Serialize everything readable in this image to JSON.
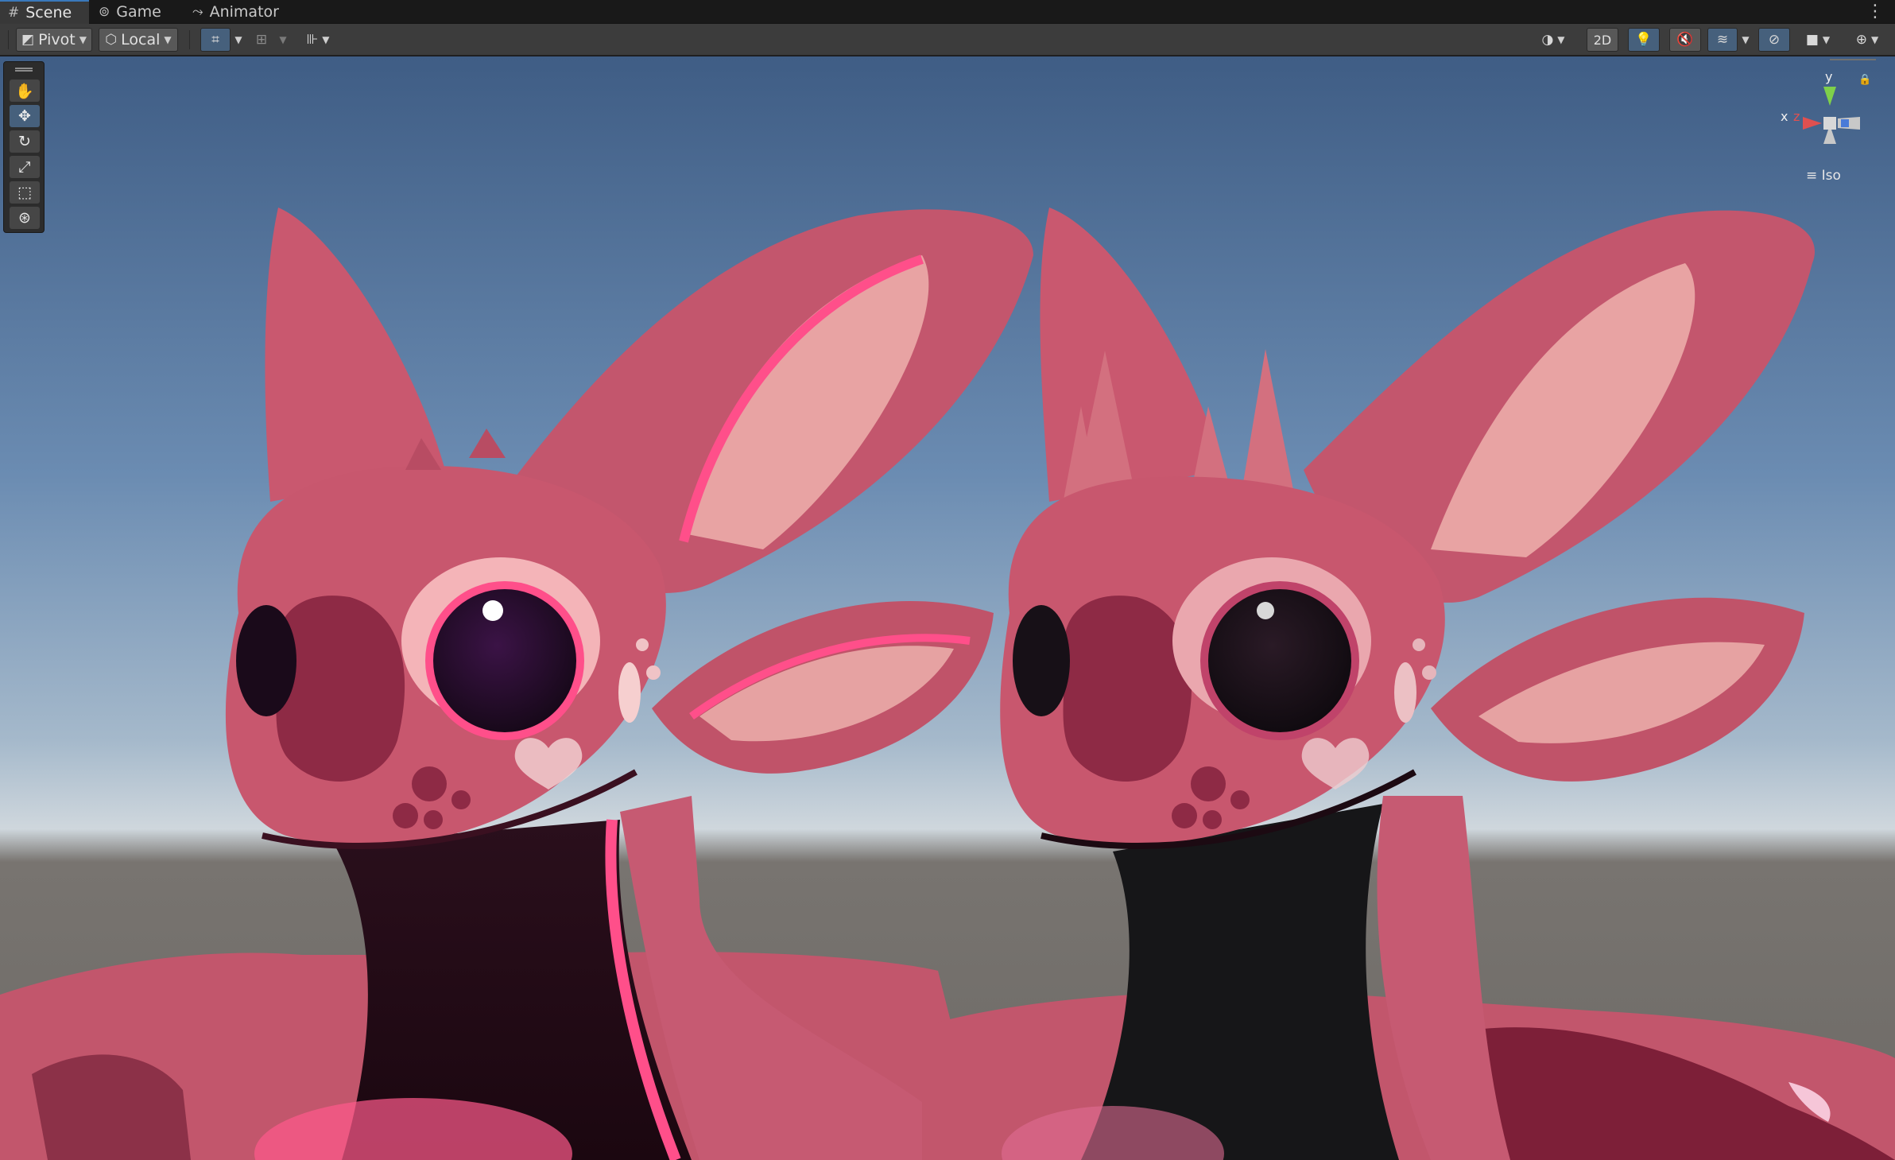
{
  "tabs": [
    {
      "label": "Scene",
      "icon": "grid-icon",
      "active": true
    },
    {
      "label": "Game",
      "icon": "gamepad-icon",
      "active": false
    },
    {
      "label": "Animator",
      "icon": "animator-icon",
      "active": false
    }
  ],
  "toolbar": {
    "pivot_label": "Pivot",
    "local_label": "Local",
    "mode_2d_label": "2D"
  },
  "tools": [
    "hand-tool",
    "move-tool",
    "rotate-tool",
    "scale-tool",
    "rect-tool",
    "transform-tool"
  ],
  "selected_tool": "move-tool",
  "gizmo": {
    "y_label": "y",
    "x_label": "x",
    "z_label": "z",
    "projection_label": "Iso"
  },
  "colors": {
    "accent": "#3a79bb",
    "skin_pink": "#c6566d",
    "glow_pink": "#ff4f8a",
    "eye_dark": "#2a0c2a"
  }
}
